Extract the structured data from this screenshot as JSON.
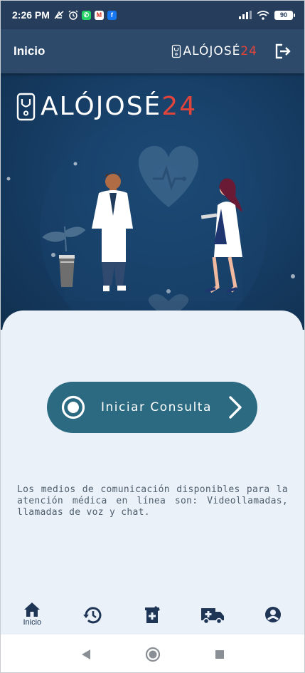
{
  "status_bar": {
    "time": "2:26 PM",
    "battery": "90",
    "icons": [
      "mute-icon",
      "alarm-icon",
      "whatsapp-icon",
      "gmail-icon",
      "facebook-icon",
      "signal-icon",
      "wifi-icon",
      "battery-icon"
    ]
  },
  "app_bar": {
    "title": "Inicio",
    "logo_main": "ALÓJOSÉ",
    "logo_num": "24",
    "logout_icon": "logout-icon"
  },
  "hero": {
    "logo_main": "ALÓJOSÉ",
    "logo_num": "24",
    "illustration": "doctors-illustration"
  },
  "consult": {
    "label": "Iniciar Consulta",
    "icon": "record-icon",
    "chevron": "chevron-right-icon"
  },
  "info_text": "Los medios de comunicación disponibles para la atención médica en línea son: Videollamadas, llamadas de voz y chat.",
  "bottom_nav": {
    "items": [
      {
        "label": "Inicio",
        "icon": "home-icon"
      },
      {
        "label": "",
        "icon": "history-icon"
      },
      {
        "label": "",
        "icon": "prescription-icon"
      },
      {
        "label": "",
        "icon": "ambulance-icon"
      },
      {
        "label": "",
        "icon": "account-icon"
      }
    ]
  },
  "system_nav": [
    "back-icon",
    "home-circle-icon",
    "recents-icon"
  ],
  "colors": {
    "status_bar": "#263d5c",
    "app_bar": "#2d4a6b",
    "hero": "#163c63",
    "card": "#eaf1f8",
    "button": "#2b6a80",
    "accent_red": "#e0443b",
    "nav_icon": "#1f3556"
  }
}
